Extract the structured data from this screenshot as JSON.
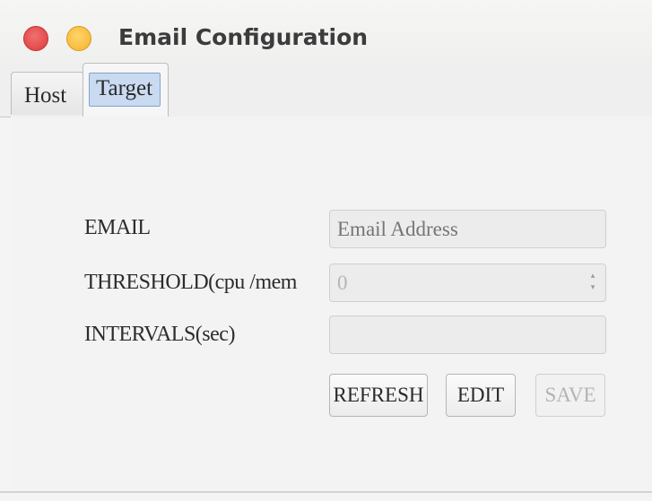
{
  "window": {
    "title": "Email Configuration"
  },
  "tabs": [
    {
      "label": "Host",
      "selected": false
    },
    {
      "label": "Target",
      "selected": true
    }
  ],
  "form": {
    "email": {
      "label": "EMAIL",
      "value": "",
      "placeholder": "Email Address"
    },
    "threshold": {
      "label": "THRESHOLD(cpu /mem",
      "value": "0"
    },
    "intervals": {
      "label": "INTERVALS(sec)",
      "value": ""
    }
  },
  "buttons": {
    "refresh": "REFRESH",
    "edit": "EDIT",
    "save": "SAVE"
  },
  "icons": {
    "close": "close-icon",
    "minimize": "minimize-icon",
    "spinner": "spinner-arrows-icon"
  },
  "colors": {
    "close": "#dd3a3a",
    "minimize": "#f5b22b",
    "selected_tab": "#c9daf1"
  }
}
